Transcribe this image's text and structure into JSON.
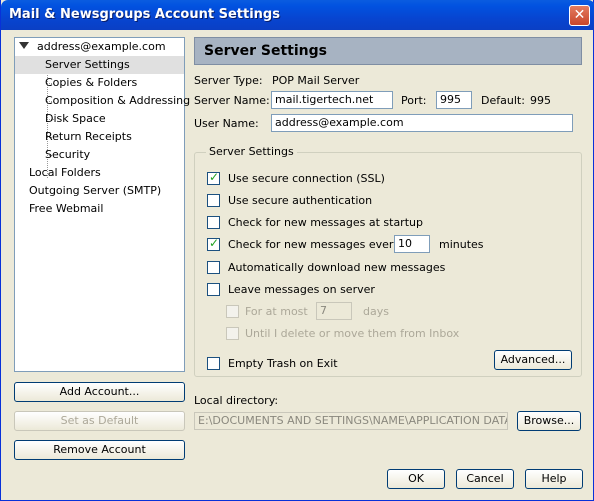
{
  "window": {
    "title": "Mail & Newsgroups Account Settings",
    "close_glyph": "✕"
  },
  "tree": {
    "account": "address@example.com",
    "sub_items": [
      "Server Settings",
      "Copies & Folders",
      "Composition & Addressing",
      "Disk Space",
      "Return Receipts",
      "Security"
    ],
    "top_items": [
      "Local Folders",
      "Outgoing Server (SMTP)",
      "Free Webmail"
    ]
  },
  "left_buttons": {
    "add_account": "Add Account...",
    "set_default": "Set as Default",
    "remove_account": "Remove Account"
  },
  "panel": {
    "header": "Server Settings",
    "server_type_label": "Server Type:",
    "server_type_value": "POP Mail Server",
    "server_name_label": "Server Name:",
    "server_name_value": "mail.tigertech.net",
    "port_label": "Port:",
    "port_value": "995",
    "default_label": "Default:",
    "default_value": "995",
    "user_name_label": "User Name:",
    "user_name_value": "address@example.com"
  },
  "group": {
    "title": "Server Settings",
    "options": {
      "ssl": "Use secure connection (SSL)",
      "secure_auth": "Use secure authentication",
      "check_startup": "Check for new messages at startup",
      "check_every": "Check for new messages every",
      "check_every_value": "10",
      "minutes": "minutes",
      "auto_download": "Automatically download new messages",
      "leave_messages": "Leave messages on server",
      "for_at_most": "For at most",
      "for_at_most_value": "7",
      "days": "days",
      "until_delete": "Until I delete or move them from Inbox",
      "empty_trash": "Empty Trash on Exit"
    },
    "advanced_button": "Advanced..."
  },
  "local_directory": {
    "label": "Local directory:",
    "value": "E:\\DOCUMENTS AND SETTINGS\\NAME\\APPLICATION DATA\\Moz",
    "browse_button": "Browse..."
  },
  "dialog_buttons": {
    "ok": "OK",
    "cancel": "Cancel",
    "help": "Help"
  },
  "colors": {
    "titlebar": "#0a4fd6",
    "dialog_bg": "#ece9d8",
    "header_bg": "#a7b3c2",
    "check": "#21a121"
  }
}
